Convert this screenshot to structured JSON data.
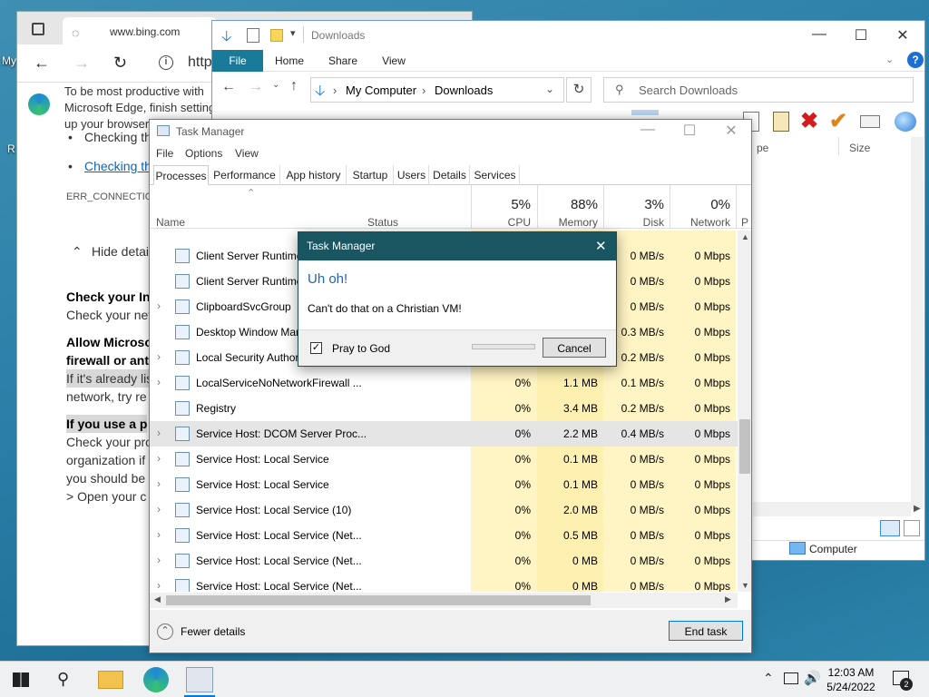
{
  "desktop": {
    "label_top": "My",
    "label_left": "R"
  },
  "edge": {
    "tab_title": "www.bing.com",
    "address": "http",
    "banner": [
      "To be most productive with",
      "Microsoft Edge, finish setting",
      "up your browser"
    ],
    "bullets": [
      "Checking th",
      "Checking th"
    ],
    "error_code": "ERR_CONNECTION_",
    "hide_details": "Hide detail",
    "p1_title": "Check your In",
    "p1_text": "Check your net",
    "p2_title_1": "Allow Microso",
    "p2_title_2": "firewall or ant",
    "p2_text_1": "If it's already lis",
    "p2_text_2": "network, try re",
    "p3_title": "If you use a p",
    "p3_text": [
      "Check your pro",
      "organization if",
      "you should be",
      "> Open your c"
    ]
  },
  "explorer": {
    "title": "Downloads",
    "ribbon_tabs": [
      "File",
      "Home",
      "Share",
      "View"
    ],
    "breadcrumb": [
      "My Computer",
      "Downloads"
    ],
    "search_placeholder": "Search Downloads",
    "column_type": "pe",
    "column_size": "Size",
    "status_location": "Computer"
  },
  "taskmanager": {
    "title": "Task Manager",
    "menu": [
      "File",
      "Options",
      "View"
    ],
    "tabs": [
      "Processes",
      "Performance",
      "App history",
      "Startup",
      "Users",
      "Details",
      "Services"
    ],
    "columns": {
      "name": "Name",
      "status": "Status",
      "cpu_pct": "5%",
      "cpu": "CPU",
      "mem_pct": "88%",
      "mem": "Memory",
      "disk_pct": "3%",
      "disk": "Disk",
      "net_pct": "0%",
      "net": "Network",
      "power": "P"
    },
    "rows": [
      {
        "name": "Client Server Runtime",
        "cpu": "",
        "mem": "",
        "disk": "0 MB/s",
        "net": "0 Mbps",
        "expand": false
      },
      {
        "name": "Client Server Runtime",
        "cpu": "",
        "mem": "",
        "disk": "0 MB/s",
        "net": "0 Mbps",
        "expand": false
      },
      {
        "name": "ClipboardSvcGroup",
        "cpu": "",
        "mem": "",
        "disk": "0 MB/s",
        "net": "0 Mbps",
        "expand": true
      },
      {
        "name": "Desktop Window Mar",
        "cpu": "",
        "mem": "",
        "disk": "0.3 MB/s",
        "net": "0 Mbps",
        "expand": false
      },
      {
        "name": "Local Security Author",
        "cpu": "",
        "mem": "",
        "disk": "0.2 MB/s",
        "net": "0 Mbps",
        "expand": true
      },
      {
        "name": "LocalServiceNoNetworkFirewall ...",
        "cpu": "0%",
        "mem": "1.1 MB",
        "disk": "0.1 MB/s",
        "net": "0 Mbps",
        "expand": true
      },
      {
        "name": "Registry",
        "cpu": "0%",
        "mem": "3.4 MB",
        "disk": "0.2 MB/s",
        "net": "0 Mbps",
        "expand": false
      },
      {
        "name": "Service Host: DCOM Server Proc...",
        "cpu": "0%",
        "mem": "2.2 MB",
        "disk": "0.4 MB/s",
        "net": "0 Mbps",
        "expand": true
      },
      {
        "name": "Service Host: Local Service",
        "cpu": "0%",
        "mem": "0.1 MB",
        "disk": "0 MB/s",
        "net": "0 Mbps",
        "expand": true
      },
      {
        "name": "Service Host: Local Service",
        "cpu": "0%",
        "mem": "0.1 MB",
        "disk": "0 MB/s",
        "net": "0 Mbps",
        "expand": true
      },
      {
        "name": "Service Host: Local Service (10)",
        "cpu": "0%",
        "mem": "2.0 MB",
        "disk": "0 MB/s",
        "net": "0 Mbps",
        "expand": true
      },
      {
        "name": "Service Host: Local Service (Net...",
        "cpu": "0%",
        "mem": "0.5 MB",
        "disk": "0 MB/s",
        "net": "0 Mbps",
        "expand": true
      },
      {
        "name": "Service Host: Local Service (Net...",
        "cpu": "0%",
        "mem": "0 MB",
        "disk": "0 MB/s",
        "net": "0 Mbps",
        "expand": true
      },
      {
        "name": "Service Host: Local Service (Net...",
        "cpu": "0%",
        "mem": "0 MB",
        "disk": "0 MB/s",
        "net": "0 Mbps",
        "expand": true
      }
    ],
    "fewer_details": "Fewer details",
    "end_task": "End task"
  },
  "dialog": {
    "title": "Task Manager",
    "heading": "Uh oh!",
    "message": "Can't do that on a Christian VM!",
    "checkbox_label": "Pray to God",
    "checkbox_checked": true,
    "cancel": "Cancel"
  },
  "taskbar": {
    "time": "12:03 AM",
    "date": "5/24/2022",
    "notifications": "2"
  },
  "colors": {
    "dialog_title": "#195662",
    "accent": "#0078d7",
    "heading": "#2266aa"
  }
}
